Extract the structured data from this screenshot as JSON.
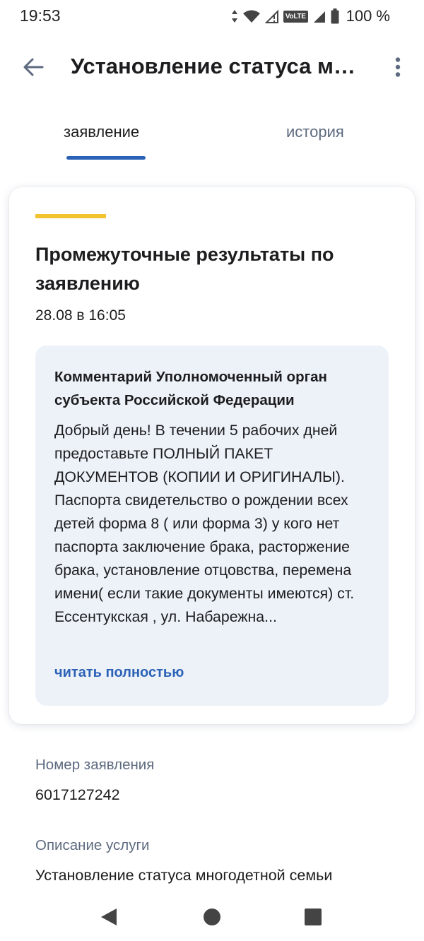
{
  "status_bar": {
    "time": "19:53",
    "volte": "VoLTE",
    "battery": "100 %"
  },
  "app_bar": {
    "title": "Установление статуса многодетной семьи"
  },
  "tabs": [
    {
      "label": "заявление",
      "active": true
    },
    {
      "label": "история",
      "active": false
    }
  ],
  "card": {
    "title": "Промежуточные результаты по заявлению",
    "date": "28.08 в 16:05",
    "comment": {
      "heading": "Комментарий Уполномоченный орган субъекта Российской Федерации",
      "text": "Добрый день! В течении 5 рабочих дней предоставьте ПОЛНЫЙ ПАКЕТ ДОКУМЕНТОВ (КОПИИ И ОРИГИНАЛЫ). Паспорта свидетельство о рождении всех детей форма 8 ( или форма 3) у кого нет паспорта заключение брака, расторжение брака, установление отцовства, перемена имени( если такие документы имеются) ст. Ессентукская , ул. Набарежна...",
      "read_more": "читать полностью"
    }
  },
  "fields": {
    "number_label": "Номер заявления",
    "number_value": "6017127242",
    "description_label": "Описание услуги",
    "description_value": "Установление статуса многодетной семьи"
  },
  "colors": {
    "accent_blue": "#2c62b6",
    "accent_yellow": "#f2c230",
    "comment_bg": "#edf2f9",
    "muted_text": "#5d6a7f"
  },
  "icons": {
    "back": "arrow-left-icon",
    "more": "more-vertical-icon",
    "nav_back": "triangle-back-icon",
    "nav_home": "circle-home-icon",
    "nav_recent": "square-recents-icon"
  }
}
